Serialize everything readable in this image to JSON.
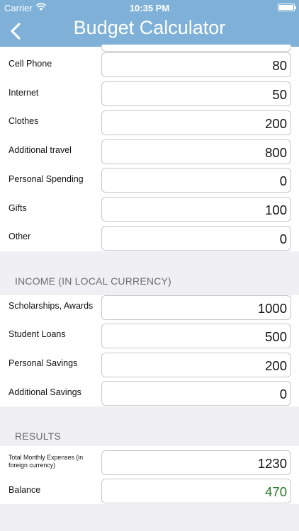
{
  "status_bar": {
    "carrier": "Carrier",
    "time": "10:35 PM"
  },
  "nav": {
    "title": "Budget Calculator"
  },
  "expenses": {
    "rows": [
      {
        "label": "Cell Phone",
        "value": "80"
      },
      {
        "label": "Internet",
        "value": "50"
      },
      {
        "label": "Clothes",
        "value": "200"
      },
      {
        "label": "Additional travel",
        "value": "800"
      },
      {
        "label": "Personal Spending",
        "value": "0"
      },
      {
        "label": "Gifts",
        "value": "100"
      },
      {
        "label": "Other",
        "value": "0"
      }
    ]
  },
  "income": {
    "header": "INCOME (IN LOCAL CURRENCY)",
    "rows": [
      {
        "label": "Scholarships, Awards",
        "value": "1000"
      },
      {
        "label": "Student Loans",
        "value": "500"
      },
      {
        "label": "Personal Savings",
        "value": "200"
      },
      {
        "label": "Additional Savings",
        "value": "0"
      }
    ]
  },
  "results": {
    "header": "RESULTS",
    "rows": [
      {
        "label": "Total Monthly Expenses (in foreign currency)",
        "value": "1230"
      },
      {
        "label": "Balance",
        "value": "470"
      }
    ],
    "balance_color": "#2a7a2a"
  },
  "colors": {
    "nav_bar": "#7fb1d8",
    "background": "#efeff4"
  }
}
